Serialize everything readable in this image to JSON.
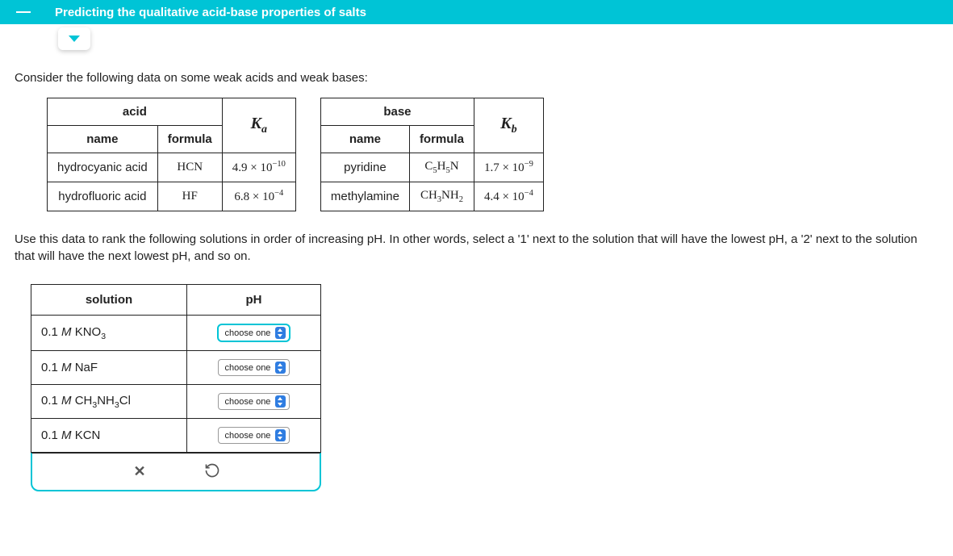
{
  "topbar": {
    "title": "Predicting the qualitative acid-base properties of salts"
  },
  "intro": "Consider the following data on some weak acids and weak bases:",
  "acid_table": {
    "group_header": "acid",
    "name_header": "name",
    "formula_header": "formula",
    "ka_header_base": "K",
    "ka_header_sub": "a",
    "rows": [
      {
        "name": "hydrocyanic acid",
        "formula": "HCN",
        "k_coef": "4.9 × 10",
        "k_exp": "−10"
      },
      {
        "name": "hydrofluoric acid",
        "formula": "HF",
        "k_coef": "6.8 × 10",
        "k_exp": "−4"
      }
    ]
  },
  "base_table": {
    "group_header": "base",
    "name_header": "name",
    "formula_header": "formula",
    "kb_header_base": "K",
    "kb_header_sub": "b",
    "rows": [
      {
        "name": "pyridine",
        "formula_html": "C5H5N",
        "k_coef": "1.7 × 10",
        "k_exp": "−9"
      },
      {
        "name": "methylamine",
        "formula_html": "CH3NH2",
        "k_coef": "4.4 × 10",
        "k_exp": "−4"
      }
    ]
  },
  "instructions": "Use this data to rank the following solutions in order of increasing pH. In other words, select a '1' next to the solution that will have the lowest pH, a '2' next to the solution that will have the next lowest pH, and so on.",
  "answer_table": {
    "solution_header": "solution",
    "ph_header": "pH",
    "choose_label": "choose one",
    "rows": [
      {
        "conc": "0.1 ",
        "unit": "M",
        "after": " KNO",
        "sub": "3",
        "tail": ""
      },
      {
        "conc": "0.1 ",
        "unit": "M",
        "after": " NaF",
        "sub": "",
        "tail": ""
      },
      {
        "conc": "0.1 ",
        "unit": "M",
        "after": " CH",
        "sub": "3",
        "tail_mid": "NH",
        "sub2": "3",
        "tail": "Cl"
      },
      {
        "conc": "0.1 ",
        "unit": "M",
        "after": " KCN",
        "sub": "",
        "tail": ""
      }
    ]
  }
}
